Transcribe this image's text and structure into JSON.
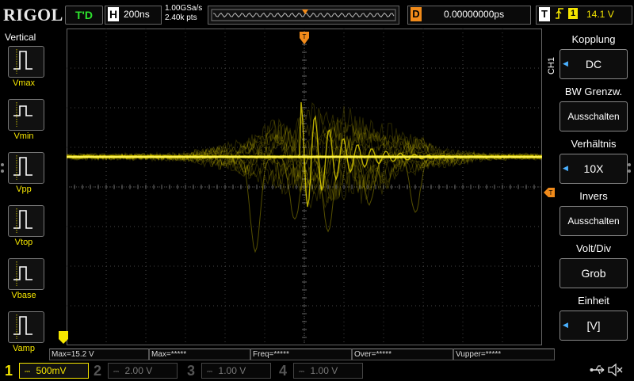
{
  "top": {
    "logo": "RIGOL",
    "status": "T'D",
    "horizontal_letter": "H",
    "horizontal_scale": "200ns",
    "sample_rate": "1.00GSa/s",
    "memory_depth": "2.40k pts",
    "delay_letter": "D",
    "delay_value": "0.00000000ps",
    "trigger_letter": "T",
    "trigger_channel": "1",
    "trigger_level": "14.1 V"
  },
  "left_panel": {
    "title": "Vertical",
    "items": [
      {
        "label": "Vmax"
      },
      {
        "label": "Vmin"
      },
      {
        "label": "Vpp"
      },
      {
        "label": "Vtop"
      },
      {
        "label": "Vbase"
      },
      {
        "label": "Vamp"
      }
    ]
  },
  "right_menu": {
    "channel": "CH1",
    "items": [
      {
        "title": "Kopplung",
        "value": "DC"
      },
      {
        "title": "BW Grenzw.",
        "value": "Ausschalten"
      },
      {
        "title": "Verhältnis",
        "value": "10X"
      },
      {
        "title": "Invers",
        "value": "Ausschalten"
      },
      {
        "title": "Volt/Div",
        "value": "Grob"
      },
      {
        "title": "Einheit",
        "value": "[V]"
      }
    ]
  },
  "measurements": [
    "Max=15.2 V",
    "Max=*****",
    "Freq=*****",
    "Over=*****",
    "Vupper=*****"
  ],
  "channels": [
    {
      "num": "1",
      "scale": "500mV",
      "color": "#f5e600"
    },
    {
      "num": "2",
      "scale": "2.00 V",
      "color": "#00c8d8"
    },
    {
      "num": "3",
      "scale": "1.00 V",
      "color": "#e040c8"
    },
    {
      "num": "4",
      "scale": "1.00 V",
      "color": "#3a7bff"
    }
  ],
  "colors": {
    "ch1": "#f5e600",
    "trigger_marker": "#f08a1a",
    "status": "#2ee32e",
    "menu_arrow": "#4ab0ff"
  },
  "icons": [
    "usb-icon",
    "speaker-muted-icon"
  ]
}
